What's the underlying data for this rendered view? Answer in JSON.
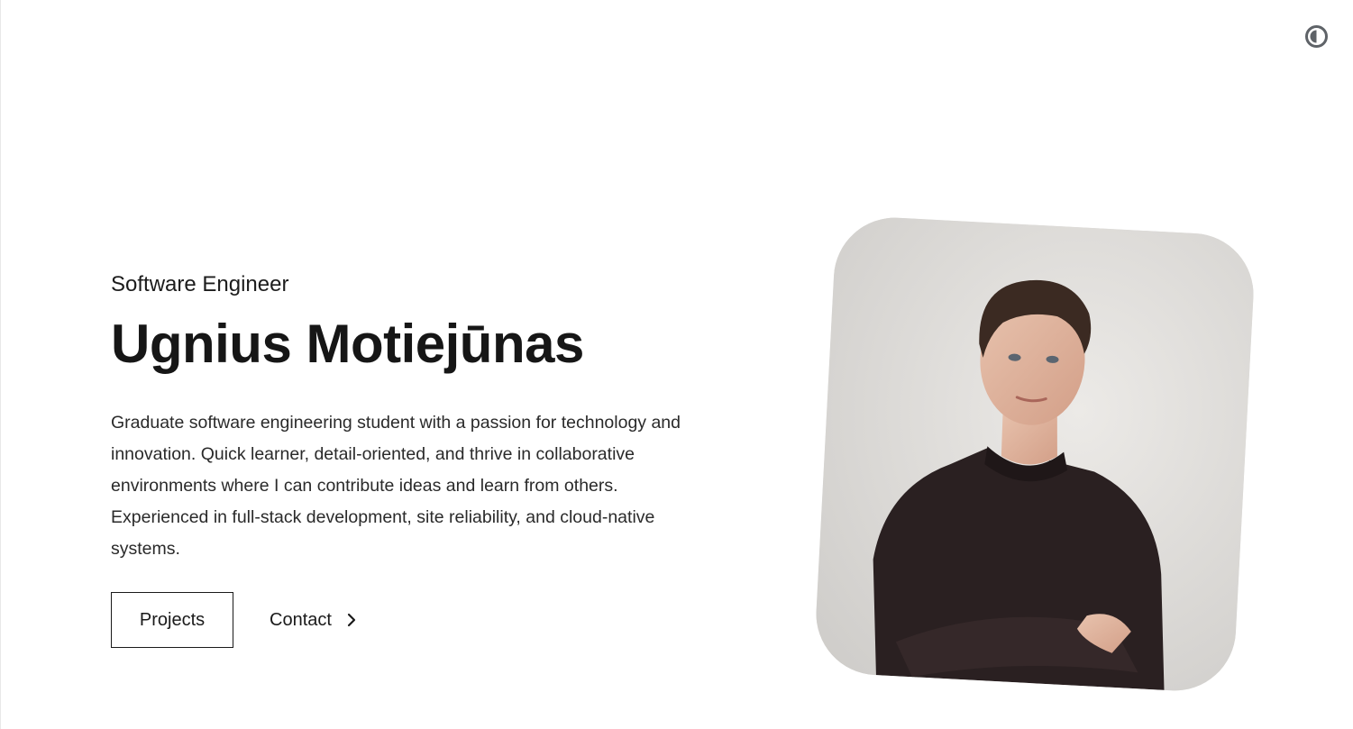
{
  "header": {
    "theme_toggle_icon": "contrast-icon"
  },
  "hero": {
    "role": "Software Engineer",
    "name": "Ugnius Motiejūnas",
    "bio": "Graduate software engineering student with a passion for technology and innovation. Quick learner, detail-oriented, and thrive in collaborative environments where I can contribute ideas and learn from others. Experienced in full-stack development, site reliability, and cloud-native systems.",
    "actions": {
      "projects_label": "Projects",
      "contact_label": "Contact",
      "contact_icon": "chevron-right-icon"
    },
    "portrait_alt": "Portrait photo"
  },
  "colors": {
    "text": "#1a1a1a",
    "background": "#ffffff"
  }
}
